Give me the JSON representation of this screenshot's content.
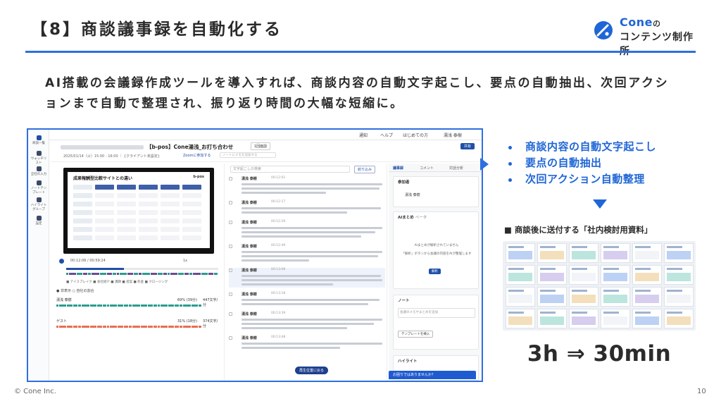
{
  "slide": {
    "title": "【8】商談議事録を自動化する",
    "lead": "AI搭載の会議録作成ツールを導入すれば、商談内容の自動文字起こし、要点の自動抽出、次回アクションまで自動で整理され、振り返り時間の大幅な短縮に。",
    "brand_name": "Cone",
    "brand_no": "の",
    "brand_sub": "コンテンツ制作所",
    "bullets": [
      "商談内容の自動文字起こし",
      "要点の自動抽出",
      "次回アクション自動整理"
    ],
    "doc_label": "■ 商談後に送付する「社内検討用資料」",
    "result": "3h ⇒ 30min",
    "footer": "© Cone Inc.",
    "page_number": "10",
    "colors": {
      "accent": "#2d6fe0",
      "bullet": "#1f66d6",
      "text": "#2b2b2b"
    }
  },
  "app": {
    "top": {
      "notify": "通知",
      "help": "ヘルプ",
      "start": "はじめての方",
      "user": "湯浅 泰樹"
    },
    "nav": [
      "商談一覧",
      "ウォッチリスト",
      "全社の入力",
      "ノートテンプレート",
      "ハイライトグループ",
      "設定"
    ],
    "title_suffix": "【b-pos】Cone湯浅_お打ち合わせ",
    "tag": "1回面談",
    "share": "共有",
    "meta": "2025/01/14（火）15:00 - 16:00 ｜ {クライアント未設定}",
    "zoom": "Zoomに参加する",
    "memo_placeholder": "ノートにメモを追加する",
    "video": {
      "slide_title": "成果報酬型比較サイトとの違い",
      "logo": "b-pos",
      "time": "00:12:06 / 00:59:24",
      "speed": "1x",
      "legend": "■ アイスブレイク ■ 会社紹介 ■ 課題 ■ 提案 ■ 料金 ■ クロージング"
    },
    "speakers": {
      "toggle": "● 非表示 ○ 自社の割合",
      "rows": [
        {
          "name": "湯浅 泰樹",
          "pct": "69% (39分)",
          "count": "447文字/分"
        },
        {
          "name": "ゲスト",
          "pct": "31% (18分)",
          "count": "374文字/分"
        }
      ]
    },
    "transcript": {
      "search_placeholder": "文字起こしの検索",
      "filter": "絞り込み",
      "return": "再生位置に戻る",
      "utterances": [
        {
          "name": "湯浅 泰樹",
          "time": "00:12:01"
        },
        {
          "name": "湯浅 泰樹",
          "time": "00:12:17"
        },
        {
          "name": "湯浅 泰樹",
          "time": "00:12:29"
        },
        {
          "name": "湯浅 泰樹",
          "time": "00:12:49"
        },
        {
          "name": "湯浅 泰樹",
          "time": "00:13:08"
        },
        {
          "name": "湯浅 泰樹",
          "time": "00:13:18"
        },
        {
          "name": "湯浅 泰樹",
          "time": "00:13:39"
        },
        {
          "name": "湯浅 泰樹",
          "time": "00:13:48"
        }
      ]
    },
    "panel": {
      "tabs": [
        "議事録",
        "コメント",
        "対話分析"
      ],
      "participants": "参加者",
      "participant_name": "湯浅 泰樹",
      "ai_summary": "AIまとめ",
      "beta": "ベータ",
      "no_summary": "AIまとめが解析されていません",
      "summary_hint": "「解析」ボタンから会議の内容をAIが整理します",
      "analyze": "解析",
      "note": "ノート",
      "note_placeholder": "会議のメモやまとめを追加",
      "template": "テンプレートを挿入",
      "highlight": "ハイライト",
      "chat": "お困りではありませんか？"
    }
  }
}
